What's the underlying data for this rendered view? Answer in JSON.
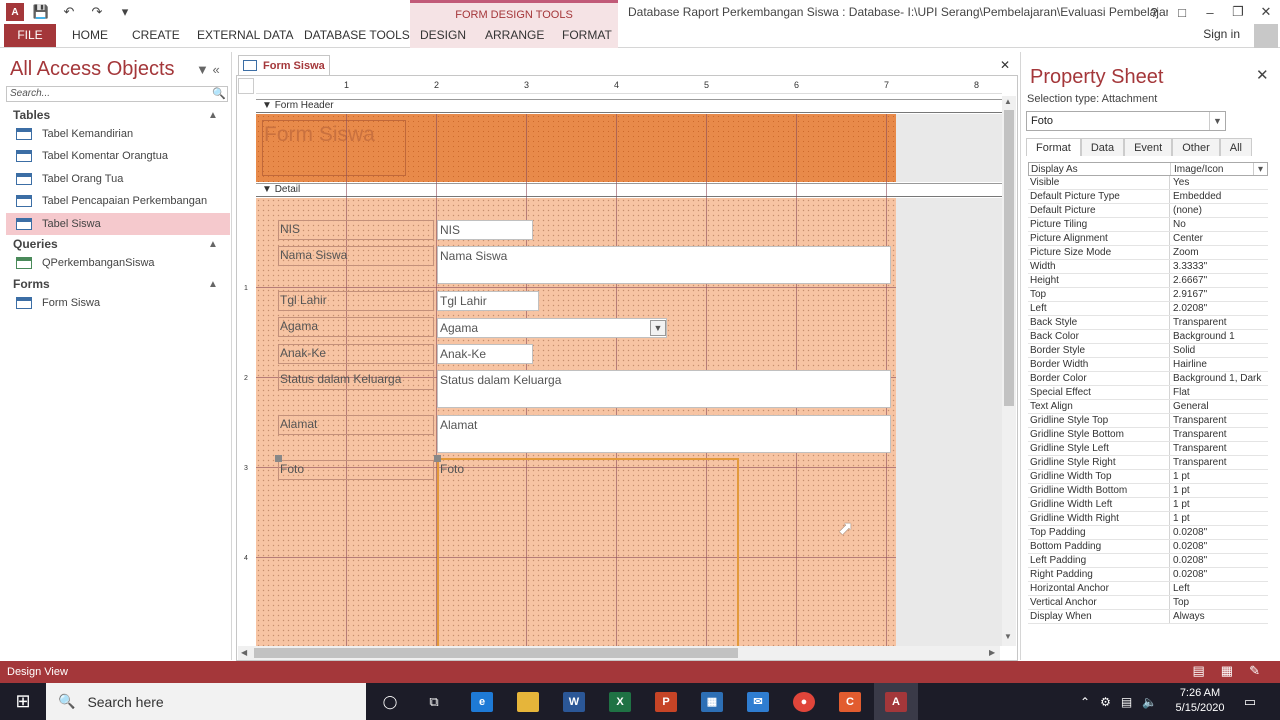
{
  "window": {
    "title": "Database Raport Perkembangan Siswa : Database- I:\\UPI Serang\\Pembelajaran\\Evaluasi Pembelajaran\\Dat...",
    "context_title": "FORM DESIGN TOOLS",
    "help": "?",
    "sign_in": "Sign in"
  },
  "ribbon": {
    "file": "FILE",
    "tabs": [
      "HOME",
      "CREATE",
      "EXTERNAL DATA",
      "DATABASE TOOLS"
    ],
    "context_tabs": [
      "DESIGN",
      "ARRANGE",
      "FORMAT"
    ]
  },
  "nav": {
    "title": "All Access Objects",
    "search_placeholder": "Search...",
    "groups": [
      {
        "label": "Tables",
        "items": [
          "Tabel Kemandirian",
          "Tabel Komentar Orangtua",
          "Tabel Orang Tua",
          "Tabel Pencapaian Perkembangan",
          "Tabel Siswa"
        ]
      },
      {
        "label": "Queries",
        "items": [
          "QPerkembanganSiswa"
        ]
      },
      {
        "label": "Forms",
        "items": [
          "Form Siswa"
        ]
      }
    ],
    "selected": "Tabel Siswa"
  },
  "document": {
    "tab_label": "Form Siswa",
    "form_header_label": "Form Header",
    "detail_label": "Detail",
    "form_title": "Form Siswa",
    "ruler_numbers": [
      "1",
      "2",
      "3",
      "4",
      "5",
      "6",
      "7",
      "8"
    ],
    "vruler_numbers": [
      "1",
      "2",
      "3",
      "4"
    ],
    "fields": [
      {
        "label": "NIS",
        "control": "NIS"
      },
      {
        "label": "Nama Siswa",
        "control": "Nama Siswa"
      },
      {
        "label": "Tgl Lahir",
        "control": "Tgl Lahir"
      },
      {
        "label": "Agama",
        "control": "Agama"
      },
      {
        "label": "Anak-Ke",
        "control": "Anak-Ke"
      },
      {
        "label": "Status dalam Keluarga",
        "control": "Status dalam Keluarga"
      },
      {
        "label": "Alamat",
        "control": "Alamat"
      },
      {
        "label": "Foto",
        "control": "Foto"
      }
    ]
  },
  "property_sheet": {
    "title": "Property Sheet",
    "selection_type": "Selection type:  Attachment",
    "selected_control": "Foto",
    "tabs": [
      "Format",
      "Data",
      "Event",
      "Other",
      "All"
    ],
    "active_tab": "Format",
    "rows": [
      [
        "Display As",
        "Image/Icon"
      ],
      [
        "Visible",
        "Yes"
      ],
      [
        "Default Picture Type",
        "Embedded"
      ],
      [
        "Default Picture",
        "(none)"
      ],
      [
        "Picture Tiling",
        "No"
      ],
      [
        "Picture Alignment",
        "Center"
      ],
      [
        "Picture Size Mode",
        "Zoom"
      ],
      [
        "Width",
        "3.3333\""
      ],
      [
        "Height",
        "2.6667\""
      ],
      [
        "Top",
        "2.9167\""
      ],
      [
        "Left",
        "2.0208\""
      ],
      [
        "Back Style",
        "Transparent"
      ],
      [
        "Back Color",
        "Background 1"
      ],
      [
        "Border Style",
        "Solid"
      ],
      [
        "Border Width",
        "Hairline"
      ],
      [
        "Border Color",
        "Background 1, Dark"
      ],
      [
        "Special Effect",
        "Flat"
      ],
      [
        "Text Align",
        "General"
      ],
      [
        "Gridline Style Top",
        "Transparent"
      ],
      [
        "Gridline Style Bottom",
        "Transparent"
      ],
      [
        "Gridline Style Left",
        "Transparent"
      ],
      [
        "Gridline Style Right",
        "Transparent"
      ],
      [
        "Gridline Width Top",
        "1 pt"
      ],
      [
        "Gridline Width Bottom",
        "1 pt"
      ],
      [
        "Gridline Width Left",
        "1 pt"
      ],
      [
        "Gridline Width Right",
        "1 pt"
      ],
      [
        "Top Padding",
        "0.0208\""
      ],
      [
        "Bottom Padding",
        "0.0208\""
      ],
      [
        "Left Padding",
        "0.0208\""
      ],
      [
        "Right Padding",
        "0.0208\""
      ],
      [
        "Horizontal Anchor",
        "Left"
      ],
      [
        "Vertical Anchor",
        "Top"
      ],
      [
        "Display When",
        "Always"
      ]
    ]
  },
  "status": {
    "text": "Design View"
  },
  "taskbar": {
    "search_placeholder": "Search here",
    "time": "7:26 AM",
    "date": "5/15/2020",
    "apps": [
      "cortana",
      "task-view",
      "edge",
      "file-explorer",
      "word",
      "excel",
      "powerpoint",
      "store",
      "mail",
      "chrome",
      "camtasia",
      "access"
    ]
  },
  "colors": {
    "accent": "#a4373a",
    "form_header": "#e88a4a",
    "detail": "#f7c4a3",
    "selection": "#e39a3b"
  }
}
